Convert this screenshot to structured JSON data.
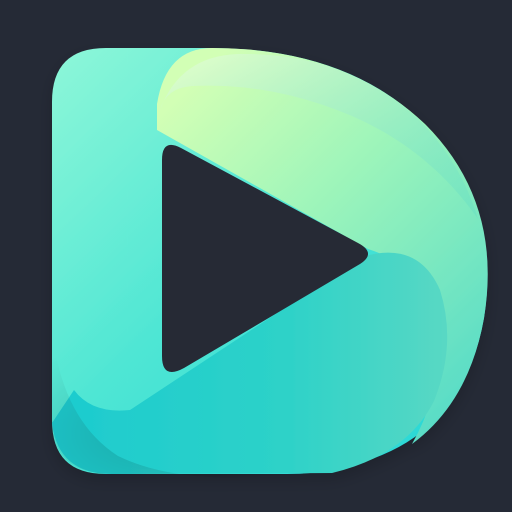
{
  "icon": {
    "name": "d-play-logo-icon",
    "colors": {
      "background": "#252a36",
      "primary": "#31e6d7",
      "secondary": "#4cd7c5",
      "highlight": "#c9ffb1",
      "shadow": "#11c8c0",
      "cutout": "#252a36"
    }
  }
}
